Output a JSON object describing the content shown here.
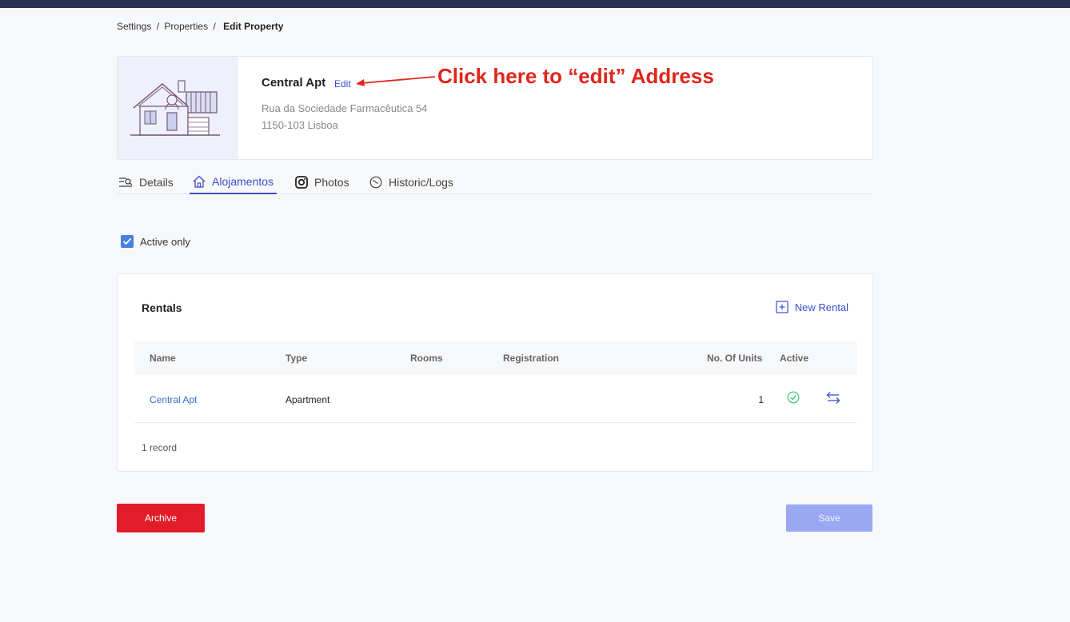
{
  "breadcrumb": {
    "items": [
      "Settings",
      "Properties"
    ],
    "separator": "/",
    "current": "Edit Property"
  },
  "property": {
    "name": "Central Apt",
    "edit_label": "Edit",
    "address_line1": "Rua da Sociedade Farmacêutica 54",
    "address_line2": "1150-103 Lisboa"
  },
  "annotation": {
    "text": "Click here to “edit” Address",
    "color": "#e0261b"
  },
  "tabs": [
    {
      "label": "Details",
      "icon": "details-icon"
    },
    {
      "label": "Alojamentos",
      "icon": "home-icon",
      "active": true
    },
    {
      "label": "Photos",
      "icon": "instagram-icon"
    },
    {
      "label": "Historic/Logs",
      "icon": "history-icon"
    }
  ],
  "filter": {
    "active_only_label": "Active only",
    "active_only_checked": true
  },
  "rentals": {
    "title": "Rentals",
    "new_button_label": "New Rental",
    "columns": [
      "Name",
      "Type",
      "Rooms",
      "Registration",
      "No. Of Units",
      "Active"
    ],
    "rows": [
      {
        "name": "Central Apt",
        "type": "Apartment",
        "rooms": "",
        "registration": "",
        "units": "1",
        "active": true
      }
    ],
    "record_count": "1 record"
  },
  "actions": {
    "archive_label": "Archive",
    "save_label": "Save"
  },
  "colors": {
    "accent": "#3a4fcf",
    "danger": "#e11d2a",
    "save_disabled": "#9aa7f2",
    "topbar": "#2b2f52"
  }
}
